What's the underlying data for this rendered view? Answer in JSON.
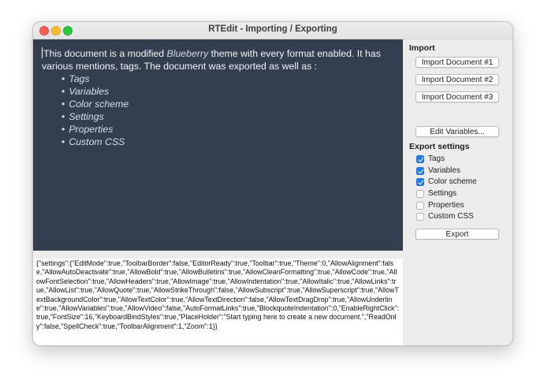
{
  "window": {
    "title": "RTEdit - Importing / Exporting"
  },
  "editor": {
    "intro_before": "This document is a modified ",
    "intro_em": "Blueberry",
    "intro_after": " theme with every format enabled. It has various mentions, tags. The document was exported as well as :",
    "list": [
      "Tags",
      "Variables",
      "Color scheme",
      "Settings",
      "Properties",
      "Custom CSS"
    ]
  },
  "json_output": "{\"settings\":{\"EditMode\":true,\"ToolbarBorder\":false,\"EditorReady\":true,\"Toolbar\":true,\"Theme\":0,\"AllowAlignment\":false,\"AllowAutoDeactivate\":true,\"AllowBold\":true,\"AllowBulletins\":true,\"AllowCleanFormatting\":true,\"AllowCode\":true,\"AllowFontSelection\":true,\"AllowHeaders\":true,\"AllowImage\":true,\"AllowIndentation\":true,\"AllowItalic\":true,\"AllowLinks\":true,\"AllowList\":true,\"AllowQuote\":true,\"AllowStrikeThrough\":false,\"AllowSubscript\":true,\"AllowSuperscript\":true,\"AllowTextBackgroundColor\":true,\"AllowTextColor\":true,\"AllowTextDirection\":false,\"AllowTextDragDrop\":true,\"AllowUnderline\":true,\"AllowVariables\":true,\"AllowVideo\":false,\"AutoFormatLinks\":true,\"BlockquoteIndentation\":0,\"EnableRightClick\":true,\"FontSize\":16,\"KeyboardBindStyles\":true,\"PlaceHolder\":\"Start typing here to create a new document.\",\"ReadOnly\":false,\"SpellCheck\":true,\"ToolbarAlignment\":1,\"Zoom\":1}}",
  "import": {
    "title": "Import",
    "buttons": [
      "Import Document #1",
      "Import Document #2",
      "Import Document #3"
    ],
    "edit_variables": "Edit Variables..."
  },
  "export": {
    "title": "Export settings",
    "options": [
      {
        "label": "Tags",
        "checked": true
      },
      {
        "label": "Variables",
        "checked": true
      },
      {
        "label": "Color scheme",
        "checked": true
      },
      {
        "label": "Settings",
        "checked": false
      },
      {
        "label": "Properties",
        "checked": false
      },
      {
        "label": "Custom CSS",
        "checked": false
      }
    ],
    "export_button": "Export"
  },
  "colors": {
    "editor_bg": "#333f4f",
    "checkbox_on": "#1f7bf2"
  }
}
